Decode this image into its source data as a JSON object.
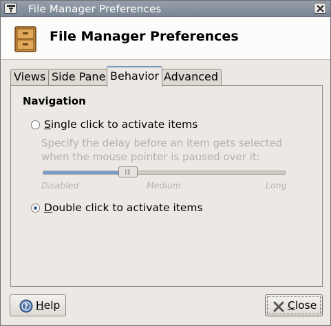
{
  "window": {
    "title": "File Manager Preferences"
  },
  "banner": {
    "title": "File Manager Preferences",
    "icon": "file-cabinet-icon"
  },
  "tabs": [
    {
      "label": "Views",
      "active": false
    },
    {
      "label": "Side Pane",
      "active": false
    },
    {
      "label": "Behavior",
      "active": true
    },
    {
      "label": "Advanced",
      "active": false
    }
  ],
  "navigation": {
    "title": "Navigation",
    "single_click": {
      "label": "Single click to activate items",
      "mnemonic": "S",
      "checked": false
    },
    "description": "Specify the delay before an item gets selected when the mouse pointer is paused over it:",
    "slider": {
      "value_fraction": 0.35,
      "enabled": false,
      "ticks": [
        "Disabled",
        "Medium",
        "Long"
      ]
    },
    "double_click": {
      "label": "Double click to activate items",
      "mnemonic": "D",
      "checked": true
    }
  },
  "buttons": {
    "help": {
      "label": "Help",
      "mnemonic": "H"
    },
    "close": {
      "label": "Close",
      "mnemonic": "C"
    }
  },
  "colors": {
    "accent": "#7a9bd0",
    "titlebar": "#8893a1",
    "window_bg": "#ece9e4"
  }
}
